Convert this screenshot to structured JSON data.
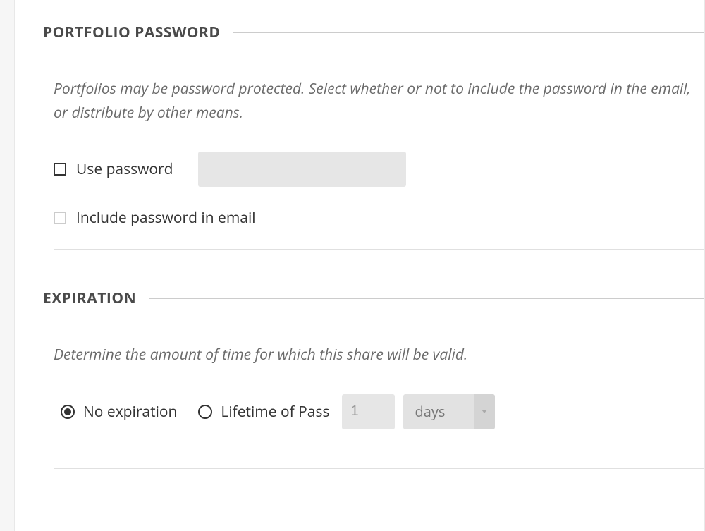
{
  "sections": {
    "password": {
      "title": "PORTFOLIO PASSWORD",
      "description": "Portfolios may be password protected. Select whether or not to include the password in the email, or distribute by other means.",
      "usePasswordLabel": "Use password",
      "usePasswordChecked": false,
      "passwordValue": "",
      "includeInEmailLabel": "Include password in email",
      "includeInEmailChecked": false
    },
    "expiration": {
      "title": "EXPIRATION",
      "description": "Determine the amount of time for which this share will be valid.",
      "noExpirationLabel": "No expiration",
      "lifetimeLabel": "Lifetime of Pass",
      "selected": "no-expiration",
      "lifetimeValue": "1",
      "lifetimeUnit": "days"
    }
  }
}
